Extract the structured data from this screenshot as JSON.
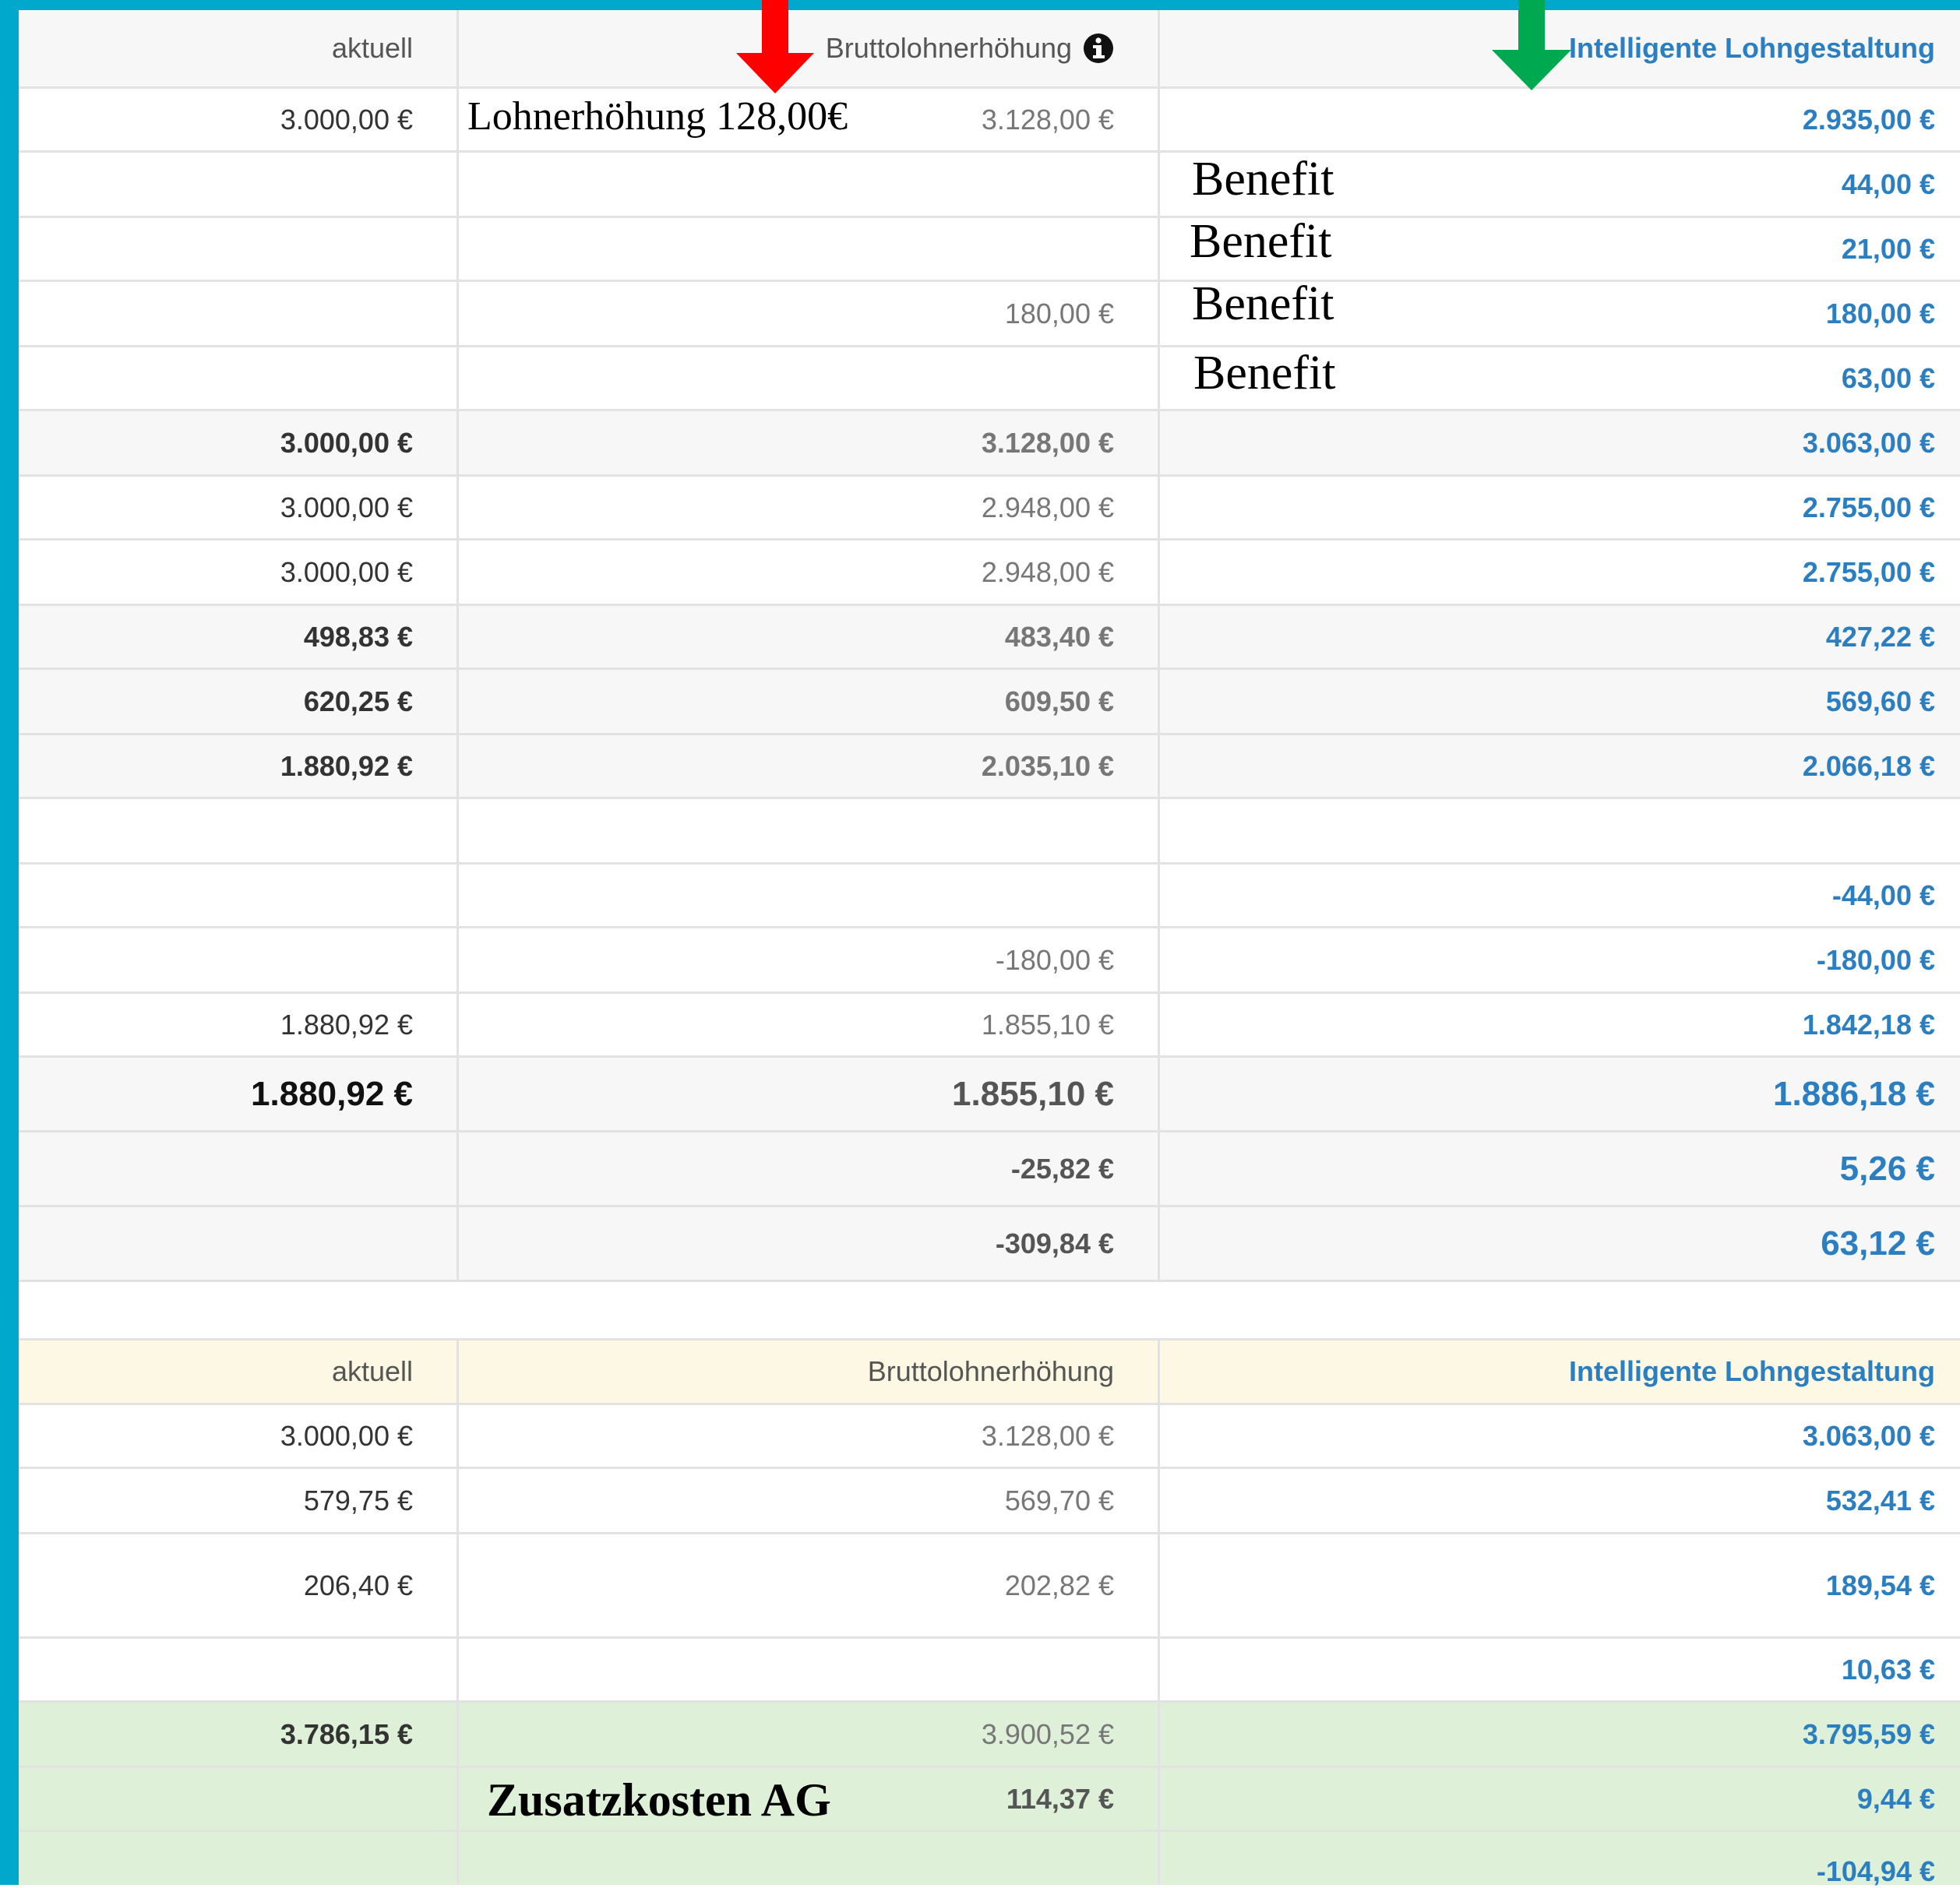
{
  "colors": {
    "frame": "#00a9cc",
    "accent_blue": "#2b7fc1",
    "arrow_red": "#ff0000",
    "arrow_green": "#00a84f"
  },
  "table1": {
    "header": {
      "col1": "aktuell",
      "col2": "Bruttolohnerhöhung",
      "col2_icon": "info-circle-icon",
      "col3": "Intelligente Lohngestaltung"
    },
    "rows": [
      {
        "c1": "3.000,00 €",
        "c2": "3.128,00 €",
        "c3": "2.935,00 €"
      },
      {
        "c1": "",
        "c2": "",
        "c3": "44,00 €"
      },
      {
        "c1": "",
        "c2": "",
        "c3": "21,00 €"
      },
      {
        "c1": "",
        "c2": "180,00 €",
        "c3": "180,00 €"
      },
      {
        "c1": "",
        "c2": "",
        "c3": "63,00 €"
      },
      {
        "c1": "3.000,00 €",
        "c2": "3.128,00 €",
        "c3": "3.063,00 €"
      },
      {
        "c1": "3.000,00 €",
        "c2": "2.948,00 €",
        "c3": "2.755,00 €"
      },
      {
        "c1": "3.000,00 €",
        "c2": "2.948,00 €",
        "c3": "2.755,00 €"
      },
      {
        "c1": "498,83 €",
        "c2": "483,40 €",
        "c3": "427,22 €"
      },
      {
        "c1": "620,25 €",
        "c2": "609,50 €",
        "c3": "569,60 €"
      },
      {
        "c1": "1.880,92 €",
        "c2": "2.035,10 €",
        "c3": "2.066,18 €"
      },
      {
        "c1": "",
        "c2": "",
        "c3": ""
      },
      {
        "c1": "",
        "c2": "",
        "c3": "-44,00 €"
      },
      {
        "c1": "",
        "c2": "-180,00 €",
        "c3": "-180,00 €"
      },
      {
        "c1": "1.880,92 €",
        "c2": "1.855,10 €",
        "c3": "1.842,18 €"
      },
      {
        "c1": "1.880,92 €",
        "c2": "1.855,10 €",
        "c3": "1.886,18 €"
      },
      {
        "c1": "",
        "c2": "-25,82 €",
        "c3": "5,26 €"
      },
      {
        "c1": "",
        "c2": "-309,84 €",
        "c3": "63,12 €"
      }
    ]
  },
  "table2": {
    "header": {
      "col1": "aktuell",
      "col2": "Bruttolohnerhöhung",
      "col3": "Intelligente Lohngestaltung"
    },
    "rows": [
      {
        "c1": "3.000,00 €",
        "c2": "3.128,00 €",
        "c3": "3.063,00 €"
      },
      {
        "c1": "579,75 €",
        "c2": "569,70 €",
        "c3": "532,41 €"
      },
      {
        "c1": "206,40 €",
        "c2": "202,82 €",
        "c3": "189,54 €"
      },
      {
        "c1": "",
        "c2": "",
        "c3": "10,63 €"
      },
      {
        "c1": "3.786,15 €",
        "c2": "3.900,52 €",
        "c3": "3.795,59 €"
      },
      {
        "c1": "",
        "c2": "114,37 €",
        "c3": "9,44 €"
      },
      {
        "c1": "",
        "c2": "",
        "c3": "-104,94 €"
      }
    ]
  },
  "annotations": {
    "raise": "Lohnerhöhung 128,00€",
    "benefit": "Benefit",
    "extra_costs": "Zusatzkosten AG"
  }
}
